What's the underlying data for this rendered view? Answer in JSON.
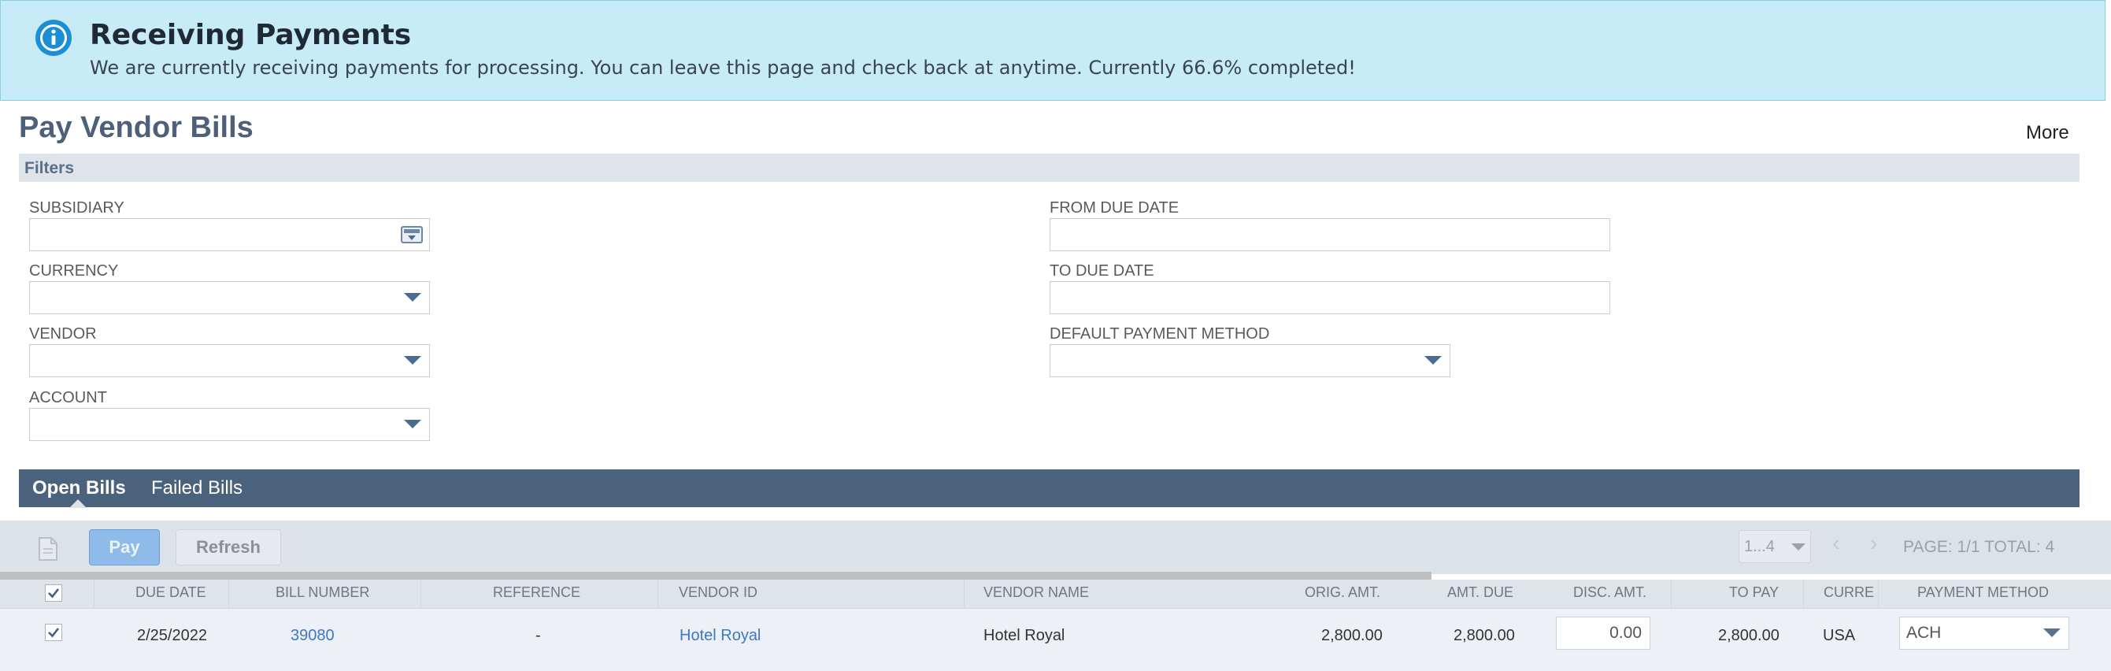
{
  "banner": {
    "title": "Receiving Payments",
    "message": "We are currently receiving payments for processing. You can leave this page and check back at anytime. Currently 66.6% completed!",
    "icon": "info-icon"
  },
  "page": {
    "title": "Pay Vendor Bills",
    "more_label": "More"
  },
  "filters": {
    "label": "Filters",
    "subsidiary": {
      "label": "SUBSIDIARY",
      "value": ""
    },
    "currency": {
      "label": "CURRENCY",
      "value": ""
    },
    "vendor": {
      "label": "VENDOR",
      "value": ""
    },
    "account": {
      "label": "ACCOUNT",
      "value": ""
    },
    "from_due_date": {
      "label": "FROM DUE DATE",
      "value": ""
    },
    "to_due_date": {
      "label": "TO DUE DATE",
      "value": ""
    },
    "default_payment_method": {
      "label": "DEFAULT PAYMENT METHOD",
      "value": ""
    }
  },
  "tabs": [
    {
      "label": "Open Bills",
      "active": true
    },
    {
      "label": "Failed Bills",
      "active": false
    }
  ],
  "toolbar": {
    "pay_label": "Pay",
    "refresh_label": "Refresh",
    "range_value": "1...4",
    "prev_icon": "‹",
    "next_icon": "›",
    "page_info": "PAGE: 1/1  TOTAL: 4"
  },
  "table": {
    "columns": [
      "DUE DATE",
      "BILL NUMBER",
      "REFERENCE",
      "VENDOR ID",
      "VENDOR NAME",
      "ORIG. AMT.",
      "AMT. DUE",
      "DISC. AMT.",
      "TO PAY",
      "CURRE",
      "PAYMENT METHOD"
    ],
    "rows": [
      {
        "checked": true,
        "due_date": "2/25/2022",
        "bill_number": "39080",
        "reference": "-",
        "vendor_id": "Hotel Royal",
        "vendor_name": "Hotel Royal",
        "orig_amt": "2,800.00",
        "amt_due": "2,800.00",
        "disc_amt": "0.00",
        "to_pay": "2,800.00",
        "currency": "USA",
        "payment_method": "ACH"
      }
    ]
  },
  "colors": {
    "banner_bg": "#c7ecf7",
    "title": "#4d5f79",
    "tab_bar": "#4a627b",
    "link": "#3d78c2",
    "pay_button": "#8ebbe9"
  }
}
